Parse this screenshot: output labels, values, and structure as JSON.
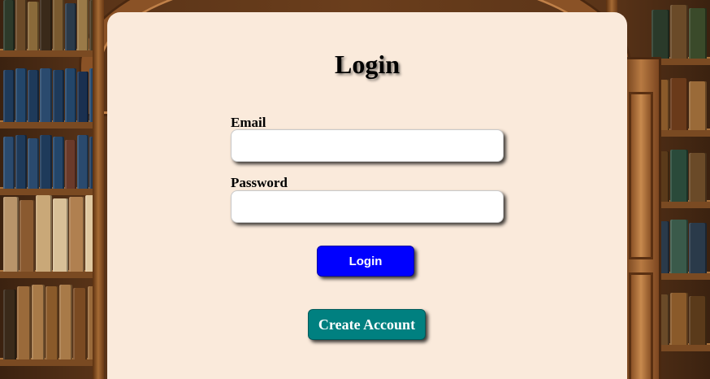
{
  "form": {
    "title": "Login",
    "email_label": "Email",
    "email_value": "",
    "password_label": "Password",
    "password_value": "",
    "login_button": "Login",
    "create_account_button": "Create Account"
  },
  "colors": {
    "card_background": "#faeadb",
    "login_button": "#0000ff",
    "create_account_button": "#008080",
    "input_background": "#ffffff"
  },
  "background": {
    "scene": "library-bookshelves-icon"
  }
}
